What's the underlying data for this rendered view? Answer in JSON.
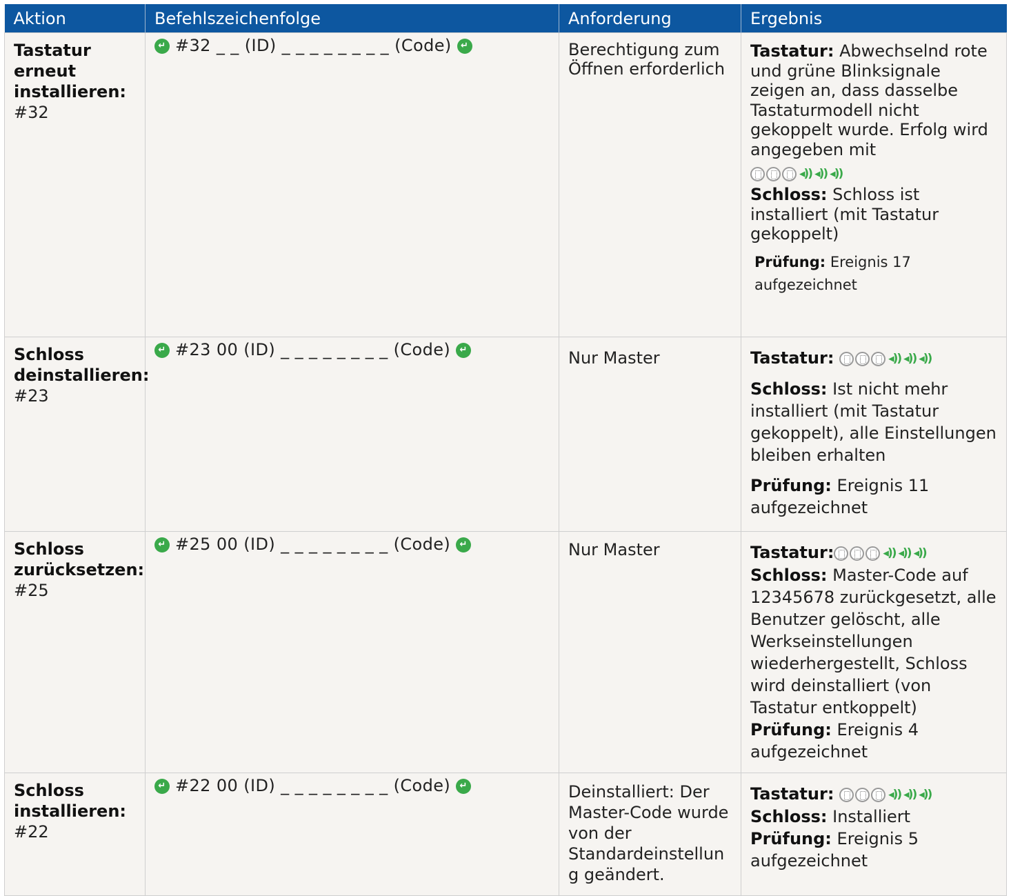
{
  "headers": [
    "Aktion",
    "Befehlszeichenfolge",
    "Anforderung",
    "Ergebnis"
  ],
  "signal_icons": {
    "keypad": "keypad-led-icon",
    "speaker": "speaker-beep-icon",
    "enter": "enter-key-icon",
    "enter_color": "#3aa94a",
    "header_color": "#0d57a0"
  },
  "rows": [
    {
      "aktion_name": "Tastatur erneut installieren:",
      "aktion_code": "#32",
      "sequence": "#32 _ _ (ID) _ _ _ _ _ _ _ _ (Code)",
      "requirement": "Berechtigung zum Öffnen erforderlich",
      "tastatur_label": "Tastatur:",
      "tastatur_text": "Abwechselnd rote und grüne Blinksignale zeigen an, dass dasselbe Tastaturmodell nicht gekoppelt wurde. Erfolg wird angegeben mit",
      "schloss_label": "Schloss:",
      "schloss_text": "Schloss ist installiert (mit Tastatur gekoppelt)",
      "pruefung_label": "Prüfung:",
      "pruefung_text": "Ereignis 17 aufgezeichnet"
    },
    {
      "aktion_name": "Schloss deinstallieren:",
      "aktion_code": "#23",
      "sequence": "#23 00 (ID) _ _ _ _ _ _ _ _ (Code)",
      "requirement": "Nur Master",
      "tastatur_label": "Tastatur:",
      "schloss_label": "Schloss:",
      "schloss_text": "Ist nicht mehr installiert (mit Tastatur gekoppelt), alle Einstellungen bleiben erhalten",
      "pruefung_label": "Prüfung:",
      "pruefung_text": "Ereignis 11 aufgezeichnet"
    },
    {
      "aktion_name": "Schloss zurücksetzen:",
      "aktion_code": "#25",
      "sequence": "#25 00 (ID) _ _ _ _ _ _ _ _ (Code)",
      "requirement": "Nur Master",
      "tastatur_label": "Tastatur:",
      "schloss_label": "Schloss:",
      "schloss_text": "Master-Code auf 12345678 zurückgesetzt, alle Benutzer gelöscht, alle Werkseinstellungen wiederhergestellt, Schloss wird deinstalliert (von Tastatur entkoppelt)",
      "pruefung_label": "Prüfung:",
      "pruefung_text": "Ereignis 4 aufgezeichnet"
    },
    {
      "aktion_name": "Schloss installieren:",
      "aktion_code": "#22",
      "sequence": "#22 00 (ID) _ _ _ _ _ _ _ _ (Code)",
      "requirement": "Deinstalliert: Der Master-Code wurde von der Standardeinstellun g geändert.",
      "tastatur_label": "Tastatur:",
      "schloss_label": "Schloss:",
      "schloss_text": "Installiert",
      "pruefung_label": "Prüfung:",
      "pruefung_text": "Ereignis 5 aufgezeichnet"
    }
  ]
}
